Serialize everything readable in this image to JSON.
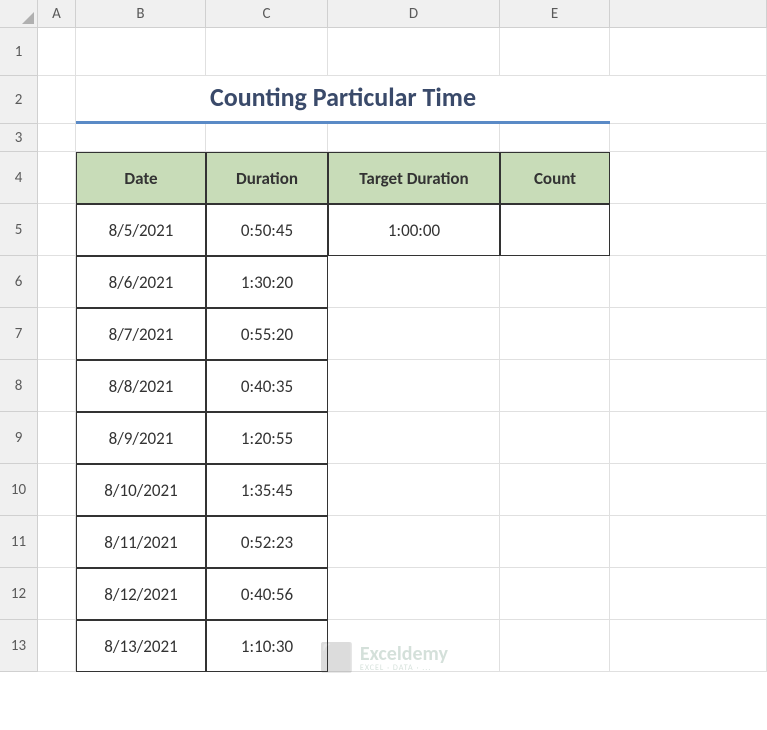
{
  "columns": [
    "A",
    "B",
    "C",
    "D",
    "E"
  ],
  "rows": [
    "1",
    "2",
    "3",
    "4",
    "5",
    "6",
    "7",
    "8",
    "9",
    "10",
    "11",
    "12",
    "13"
  ],
  "title": "Counting Particular Time",
  "headers": {
    "date": "Date",
    "duration": "Duration",
    "target": "Target Duration",
    "count": "Count"
  },
  "data": [
    {
      "date": "8/5/2021",
      "duration": "0:50:45"
    },
    {
      "date": "8/6/2021",
      "duration": "1:30:20"
    },
    {
      "date": "8/7/2021",
      "duration": "0:55:20"
    },
    {
      "date": "8/8/2021",
      "duration": "0:40:35"
    },
    {
      "date": "8/9/2021",
      "duration": "1:20:55"
    },
    {
      "date": "8/10/2021",
      "duration": "1:35:45"
    },
    {
      "date": "8/11/2021",
      "duration": "0:52:23"
    },
    {
      "date": "8/12/2021",
      "duration": "0:40:56"
    },
    {
      "date": "8/13/2021",
      "duration": "1:10:30"
    }
  ],
  "target_duration": "1:00:00",
  "count": "",
  "watermark": {
    "main": "Exceldemy",
    "sub": "EXCEL · DATA · ..."
  }
}
